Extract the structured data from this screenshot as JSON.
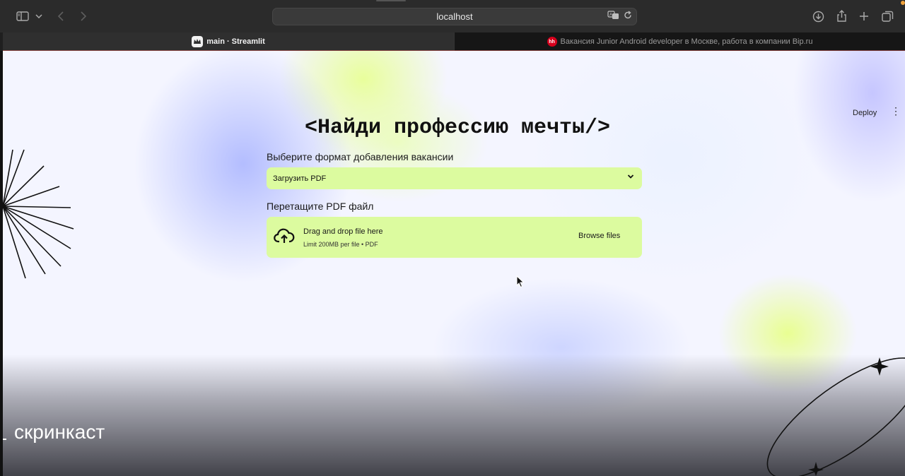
{
  "browser": {
    "url": "localhost",
    "tabs": [
      {
        "label": "main · Streamlit",
        "active": true,
        "favicon": "streamlit-crown-icon"
      },
      {
        "label": "Вакансия Junior Android developer в Москве, работа в компании Bip.ru",
        "active": false,
        "favicon": "hh-icon",
        "favicon_text": "hh"
      }
    ]
  },
  "app": {
    "deploy_label": "Deploy",
    "menu_icon": "⋮",
    "title": "<Найди профессию мечты/>",
    "format_label": "Выберите формат добавления вакансии",
    "format_value": "Загрузить PDF",
    "upload_label": "Перетащите PDF файл",
    "uploader": {
      "title": "Drag and drop file here",
      "subtitle": "Limit 200MB per file • PDF",
      "browse_label": "Browse files"
    },
    "accent_color": "#dcfb9f"
  },
  "overlay": {
    "watermark": "скринкаст"
  }
}
